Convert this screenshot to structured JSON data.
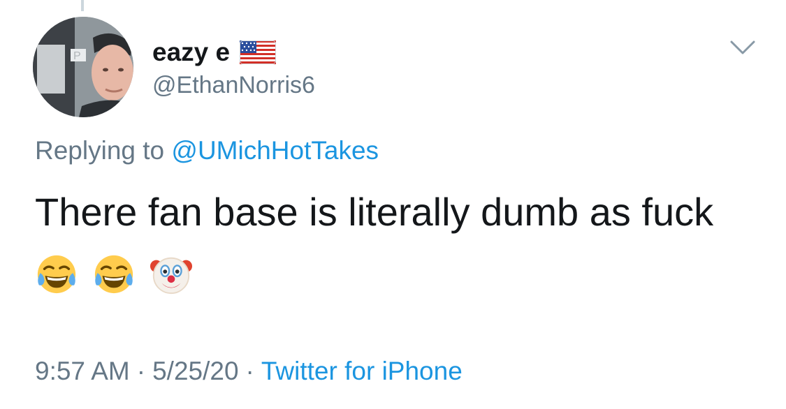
{
  "tweet": {
    "author": {
      "display_name": "eazy e",
      "flag_icon": "us-flag-icon",
      "handle": "@EthanNorris6"
    },
    "reply": {
      "prefix": "Replying to",
      "mention": "@UMichHotTakes"
    },
    "text": "There fan base is literally dumb as fuck",
    "emojis": [
      "face-with-tears-of-joy",
      "face-with-tears-of-joy",
      "clown-face"
    ],
    "meta": {
      "time": "9:57 AM",
      "separator": "·",
      "date": "5/25/20",
      "source": "Twitter for iPhone"
    }
  },
  "colors": {
    "text_primary": "#14171a",
    "text_secondary": "#657786",
    "link": "#1b95e0",
    "thread_line": "#ccd6dd"
  }
}
